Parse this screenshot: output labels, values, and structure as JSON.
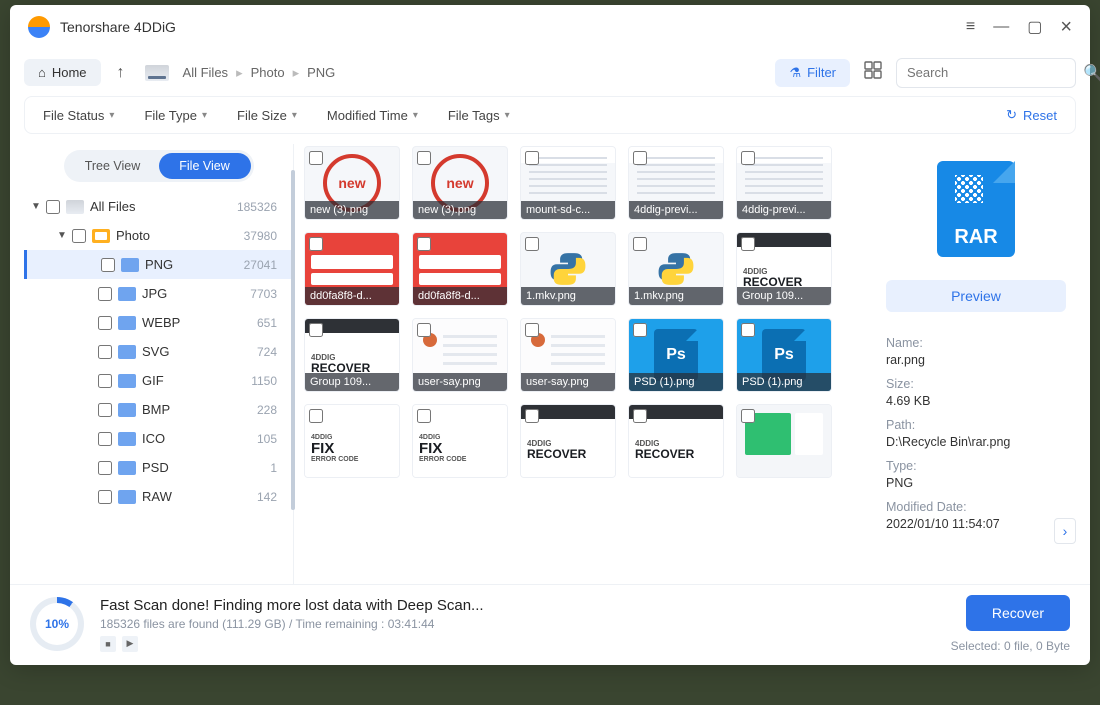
{
  "app": {
    "title": "Tenorshare 4DDiG"
  },
  "toolbar": {
    "home": "Home",
    "breadcrumbs": [
      "All Files",
      "Photo",
      "PNG"
    ],
    "filter": "Filter",
    "search_placeholder": "Search"
  },
  "filters": {
    "file_status": "File Status",
    "file_type": "File Type",
    "file_size": "File Size",
    "modified_time": "Modified Time",
    "file_tags": "File Tags",
    "reset": "Reset"
  },
  "sidebar": {
    "tree_view": "Tree View",
    "file_view": "File View",
    "nodes": [
      {
        "label": "All Files",
        "count": "185326",
        "depth": 0,
        "icon": "drive",
        "expand": "▼"
      },
      {
        "label": "Photo",
        "count": "37980",
        "depth": 1,
        "icon": "photo",
        "expand": "▼"
      },
      {
        "label": "PNG",
        "count": "27041",
        "depth": 2,
        "icon": "folder",
        "selected": true
      },
      {
        "label": "JPG",
        "count": "7703",
        "depth": 2,
        "icon": "folder"
      },
      {
        "label": "WEBP",
        "count": "651",
        "depth": 2,
        "icon": "folder"
      },
      {
        "label": "SVG",
        "count": "724",
        "depth": 2,
        "icon": "folder"
      },
      {
        "label": "GIF",
        "count": "1150",
        "depth": 2,
        "icon": "folder"
      },
      {
        "label": "BMP",
        "count": "228",
        "depth": 2,
        "icon": "folder"
      },
      {
        "label": "ICO",
        "count": "105",
        "depth": 2,
        "icon": "folder"
      },
      {
        "label": "PSD",
        "count": "1",
        "depth": 2,
        "icon": "folder"
      },
      {
        "label": "RAW",
        "count": "142",
        "depth": 2,
        "icon": "folder"
      }
    ]
  },
  "grid": {
    "items": [
      {
        "name": "new (3).png",
        "kind": "new"
      },
      {
        "name": "new (3).png",
        "kind": "new"
      },
      {
        "name": "mount-sd-c...",
        "kind": "doc"
      },
      {
        "name": "4ddig-previ...",
        "kind": "doc"
      },
      {
        "name": "4ddig-previ...",
        "kind": "doc"
      },
      {
        "name": "dd0fa8f8-d...",
        "kind": "red"
      },
      {
        "name": "dd0fa8f8-d...",
        "kind": "red"
      },
      {
        "name": "1.mkv.png",
        "kind": "py"
      },
      {
        "name": "1.mkv.png",
        "kind": "py"
      },
      {
        "name": "Group 109...",
        "kind": "rec"
      },
      {
        "name": "Group 109...",
        "kind": "rec"
      },
      {
        "name": "user-say.png",
        "kind": "user"
      },
      {
        "name": "user-say.png",
        "kind": "user"
      },
      {
        "name": "PSD (1).png",
        "kind": "ps"
      },
      {
        "name": "PSD (1).png",
        "kind": "ps"
      },
      {
        "name": "",
        "kind": "fix"
      },
      {
        "name": "",
        "kind": "fix"
      },
      {
        "name": "",
        "kind": "rec"
      },
      {
        "name": "",
        "kind": "rec"
      },
      {
        "name": "",
        "kind": "dash"
      }
    ],
    "rec_small": "4DDIG",
    "rec_big": "RECOVER",
    "fix_big": "FIX",
    "fix_small": "ERROR CODE",
    "new_label": "new"
  },
  "preview": {
    "button": "Preview",
    "rar_label": "RAR",
    "meta": {
      "name_k": "Name:",
      "name_v": "rar.png",
      "size_k": "Size:",
      "size_v": "4.69 KB",
      "path_k": "Path:",
      "path_v": "D:\\Recycle Bin\\rar.png",
      "type_k": "Type:",
      "type_v": "PNG",
      "mod_k": "Modified Date:",
      "mod_v": "2022/01/10 11:54:07"
    }
  },
  "footer": {
    "percent": "10%",
    "title": "Fast Scan done! Finding more lost data with Deep Scan...",
    "subtitle": "185326 files are found (111.29 GB)  /  Time remaining : 03:41:44",
    "recover": "Recover",
    "selected": "Selected: 0 file, 0 Byte"
  }
}
